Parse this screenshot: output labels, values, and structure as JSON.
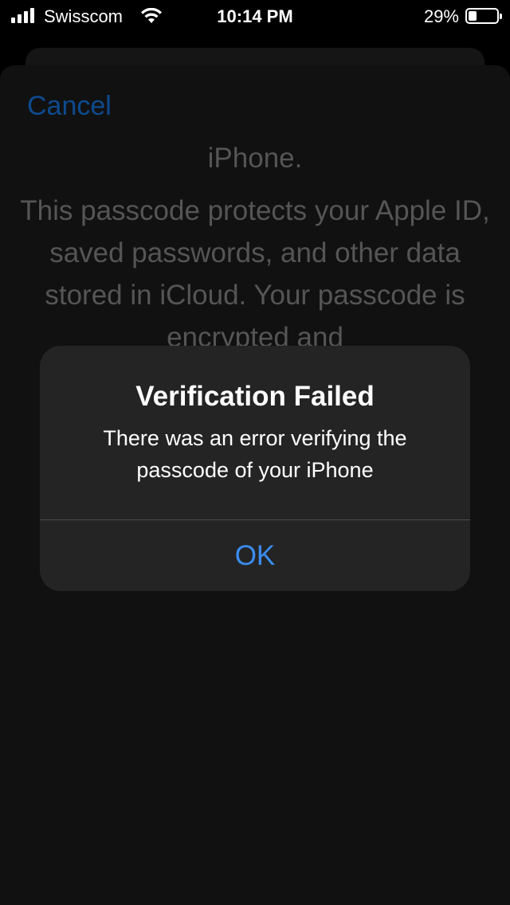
{
  "status_bar": {
    "carrier": "Swisscom",
    "time": "10:14 PM",
    "battery_percent": "29%",
    "battery_level": 0.29,
    "signal_bars": 4,
    "icons": [
      "signal-icon",
      "wifi-icon",
      "battery-icon"
    ]
  },
  "sheet": {
    "cancel_label": "Cancel",
    "partial_line": "iPhone.",
    "paragraph": "This passcode protects your Apple ID, saved passwords, and other data stored in iCloud. Your passcode is encrypted and"
  },
  "alert": {
    "title": "Verification Failed",
    "message": "There was an error verifying the passcode of your iPhone",
    "ok_label": "OK"
  },
  "colors": {
    "accent": "#3a8df0",
    "dimmed_link": "#0e4a8e",
    "alert_background": "#242424"
  }
}
